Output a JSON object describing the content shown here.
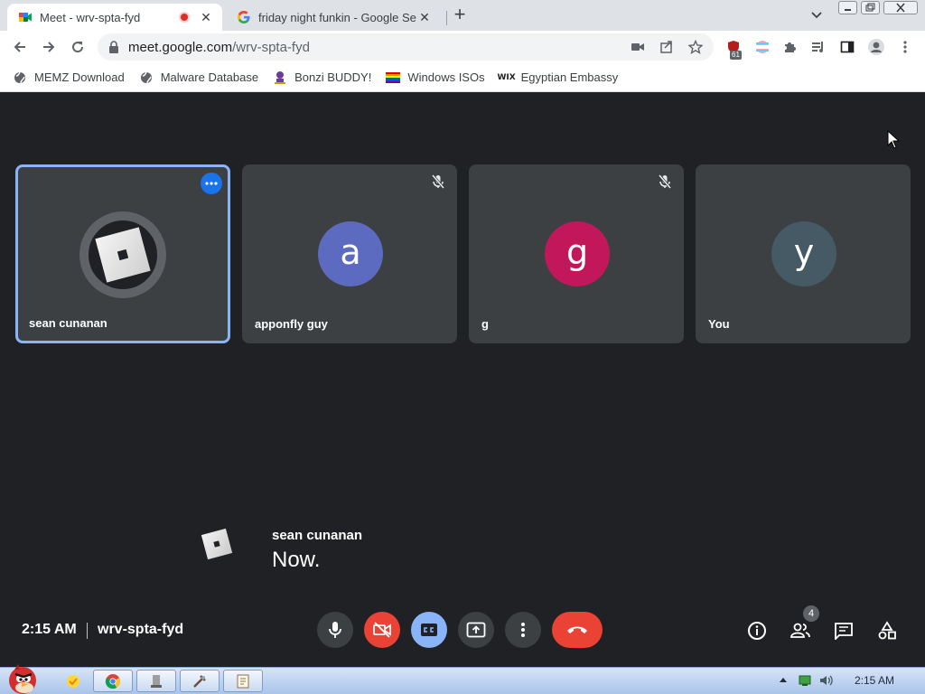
{
  "browser": {
    "tabs": [
      {
        "title": "Meet - wrv-spta-fyd",
        "recording": true
      },
      {
        "title": "friday night funkin - Google Se"
      }
    ],
    "url": {
      "domain": "meet.google.com",
      "path": "/wrv-spta-fyd"
    },
    "extension_badge": "61",
    "bookmarks": [
      {
        "label": "MEMZ Download",
        "icon": "globe-icon"
      },
      {
        "label": "Malware Database",
        "icon": "globe-icon"
      },
      {
        "label": "Bonzi BUDDY!",
        "icon": "bonzi-icon"
      },
      {
        "label": "Windows ISOs",
        "icon": "rainbow-flag-icon"
      },
      {
        "label": "Egyptian Embassy",
        "icon": "wix-icon"
      }
    ]
  },
  "meet": {
    "participants": [
      {
        "name": "sean cunanan",
        "avatar": "roblox-logo",
        "active_speaker": true
      },
      {
        "name": "apponfly guy",
        "initial": "a",
        "color": "#5c6bc0",
        "muted": true
      },
      {
        "name": "g",
        "initial": "g",
        "color": "#c2185b",
        "muted": true
      },
      {
        "name": "You",
        "initial": "y",
        "color": "#455a64"
      }
    ],
    "caption": {
      "speaker": "sean cunanan",
      "text": "Now."
    },
    "clock": "2:15 AM",
    "meeting_code": "wrv-spta-fyd",
    "people_count": "4",
    "accent": "#8ab4f8",
    "end_call_color": "#ea4335"
  },
  "taskbar": {
    "time": "2:15 AM",
    "apps": [
      "chrome",
      "app-2",
      "app-3",
      "app-4"
    ]
  }
}
